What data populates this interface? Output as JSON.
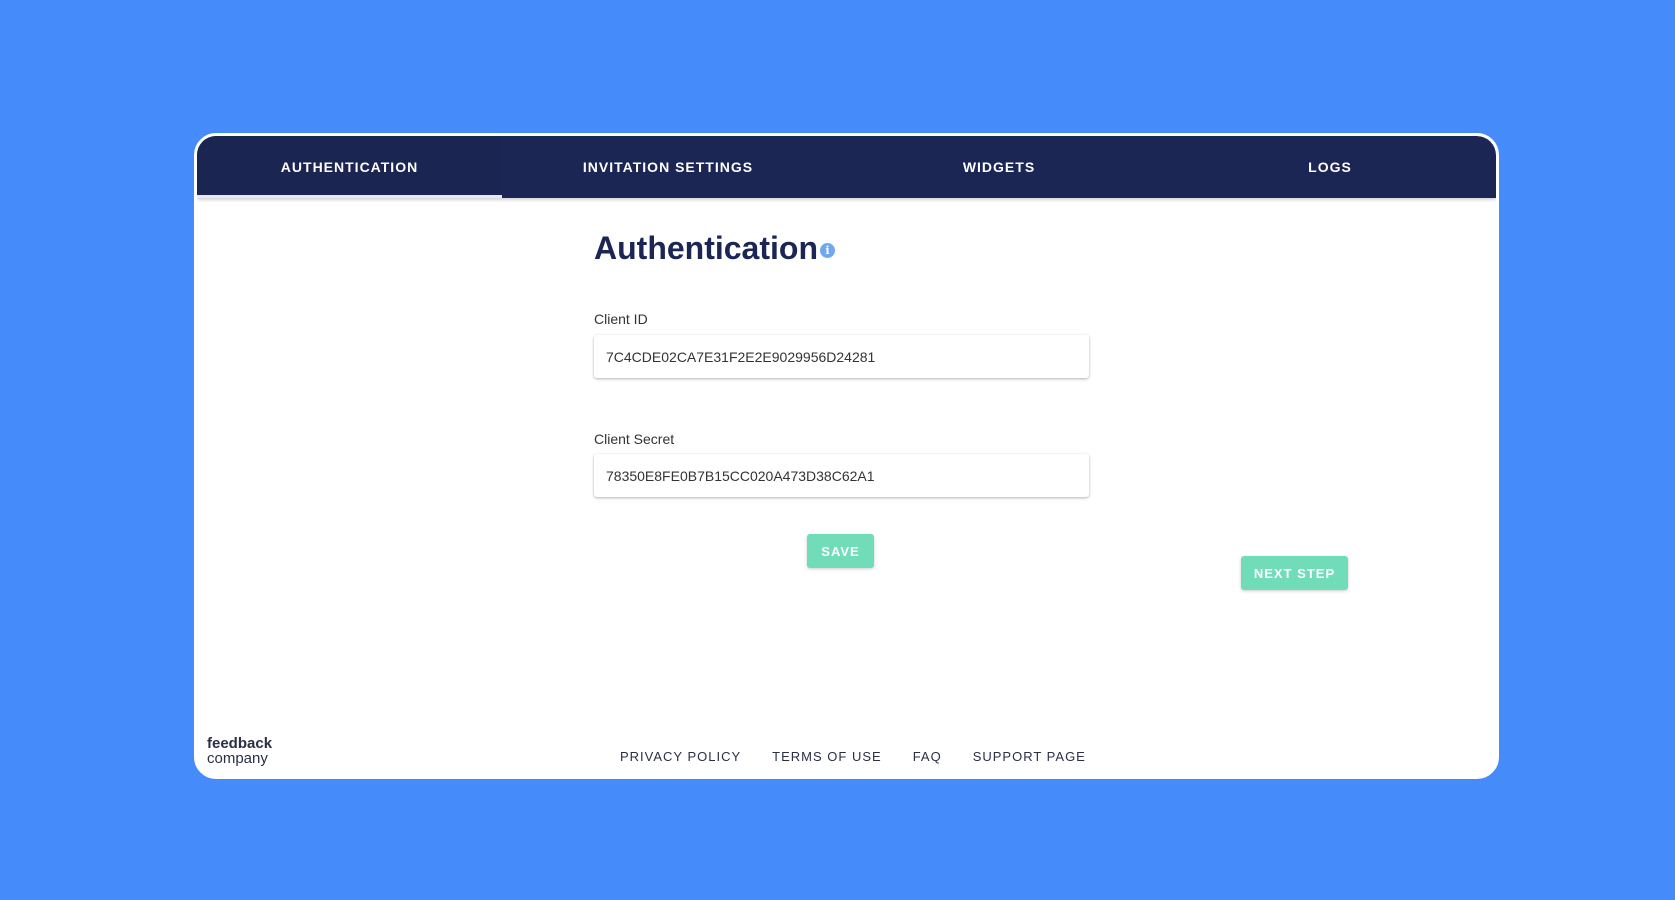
{
  "tabs": [
    {
      "label": "AUTHENTICATION",
      "active": true
    },
    {
      "label": "INVITATION SETTINGS",
      "active": false
    },
    {
      "label": "WIDGETS",
      "active": false
    },
    {
      "label": "LOGS",
      "active": false
    }
  ],
  "page": {
    "title": "Authentication",
    "info_icon": "info-icon"
  },
  "form": {
    "client_id_label": "Client ID",
    "client_id_value": "7C4CDE02CA7E31F2E2E9029956D24281",
    "client_secret_label": "Client Secret",
    "client_secret_value": "78350E8FE0B7B15CC020A473D38C62A1",
    "save_label": "SAVE",
    "next_step_label": "NEXT STEP"
  },
  "footer": {
    "logo_line1": "feedback",
    "logo_line2": "company",
    "links": [
      "PRIVACY POLICY",
      "TERMS OF USE",
      "FAQ",
      "SUPPORT PAGE"
    ]
  },
  "colors": {
    "background": "#458cfa",
    "tab_bar": "#1b2654",
    "title": "#1b2654",
    "button": "#70dcb8",
    "info_icon": "#6fa8ee"
  }
}
